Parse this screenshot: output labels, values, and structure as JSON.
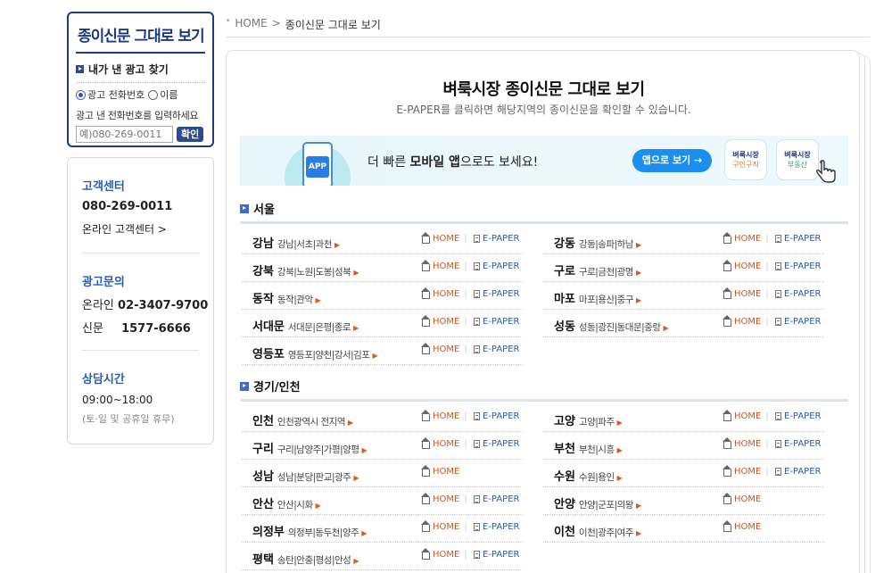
{
  "sidebar": {
    "paper_title": "종이신문 그대로 보기",
    "find_ad_label": "내가 낸 광고 찾기",
    "radio_phone": "광고 전화번호",
    "radio_name": "이름",
    "hint": "광고 낸 전화번호를 입력하세요",
    "input_placeholder": "예)080-269-0011",
    "confirm": "확인",
    "cs_title": "고객센터",
    "cs_phone": "080-269-0011",
    "cs_online": "온라인 고객센터 >",
    "ad_title": "광고문의",
    "ad_online_label": "온라인",
    "ad_online_phone": "02-3407-9700",
    "ad_paper_label": "신문",
    "ad_paper_phone": "1577-6666",
    "hours_title": "상담시간",
    "hours": "09:00~18:00",
    "hours_note": "(토·일 및 공휴일 휴무)"
  },
  "breadcrumb": {
    "home": "HOME",
    "sep": ">",
    "current": "종이신문 그대로 보기",
    "dot": "•"
  },
  "main": {
    "title": "벼룩시장 종이신문 그대로 보기",
    "subtitle": "E-PAPER를 클릭하면 해당지역의 종이신문을 확인할 수 있습니다.",
    "banner": {
      "app_icon": "APP",
      "msg_pre": "더 빠른 ",
      "msg_bold": "모바일 앱",
      "msg_post": "으로도 보세요!",
      "button": "앱으로 보기 →",
      "tile1_a": "벼룩시장",
      "tile1_b": "구인구직",
      "tile2_a": "벼룩시장",
      "tile2_b": "부동산"
    },
    "home_label": "HOME",
    "epaper_label": "E-PAPER",
    "sections": [
      {
        "name": "서울",
        "rows": [
          {
            "city": "강남",
            "areas": "강남|서초|과천",
            "epaper": true
          },
          {
            "city": "강동",
            "areas": "강동|송파|하남",
            "epaper": true
          },
          {
            "city": "강북",
            "areas": "강북|노원|도봉|성북",
            "epaper": true
          },
          {
            "city": "구로",
            "areas": "구로|금천|광명",
            "epaper": true
          },
          {
            "city": "동작",
            "areas": "동작|관악",
            "epaper": true
          },
          {
            "city": "마포",
            "areas": "마포|용산|중구",
            "epaper": true
          },
          {
            "city": "서대문",
            "areas": "서대문|은평|종로",
            "epaper": true
          },
          {
            "city": "성동",
            "areas": "성동|광진|동대문|중랑",
            "epaper": true
          },
          {
            "city": "영등포",
            "areas": "영등포|양천|강서|김포",
            "epaper": true
          }
        ]
      },
      {
        "name": "경기/인천",
        "rows": [
          {
            "city": "인천",
            "areas": "인천광역시 전지역",
            "epaper": true
          },
          {
            "city": "고양",
            "areas": "고양|파주",
            "epaper": true
          },
          {
            "city": "구리",
            "areas": "구리|남양주|가평|양평",
            "epaper": true
          },
          {
            "city": "부천",
            "areas": "부천|시흥",
            "epaper": true
          },
          {
            "city": "성남",
            "areas": "성남|분당|판교|광주",
            "epaper": false
          },
          {
            "city": "수원",
            "areas": "수원|용인",
            "epaper": true
          },
          {
            "city": "안산",
            "areas": "안산|시화",
            "epaper": true
          },
          {
            "city": "안양",
            "areas": "안양|군포|의왕",
            "epaper": false
          },
          {
            "city": "의정부",
            "areas": "의정부|동두천|양주",
            "epaper": true
          },
          {
            "city": "이천",
            "areas": "이천|광주|여주",
            "epaper": false
          },
          {
            "city": "평택",
            "areas": "송탄|안중|평성|안성",
            "epaper": true
          }
        ]
      }
    ]
  }
}
